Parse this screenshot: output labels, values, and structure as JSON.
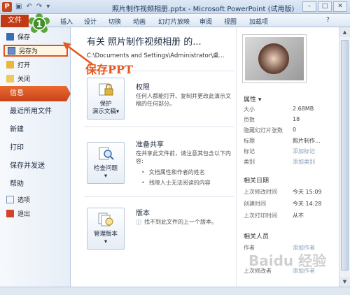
{
  "window": {
    "title": "照片制作视频相册.pptx - Microsoft PowerPoint (试用版)",
    "app_icon": "P",
    "controls": [
      "–",
      "□",
      "✕"
    ]
  },
  "ribbon": {
    "file_tab": "文件",
    "tabs": [
      "插入",
      "设计",
      "切换",
      "动画",
      "幻灯片放映",
      "审阅",
      "视图",
      "加载项"
    ]
  },
  "step_badge": "1",
  "left_menu": {
    "small_items": [
      {
        "label": "保存",
        "icon": "save-icon"
      },
      {
        "label": "另存为",
        "icon": "save-as-icon"
      },
      {
        "label": "打开",
        "icon": "open-folder-icon"
      },
      {
        "label": "关闭",
        "icon": "close-file-icon"
      }
    ],
    "big_items": [
      "信息",
      "最近所用文件",
      "新建",
      "打印",
      "保存并发送",
      "帮助"
    ],
    "bottom_items": [
      {
        "label": "选项",
        "icon": "options-icon"
      },
      {
        "label": "退出",
        "icon": "exit-icon"
      }
    ]
  },
  "annotation": "保存PPT",
  "info": {
    "title": "有关 照片制作视频相册 的...",
    "path": "C:\\Documents and Settings\\Administrator\\桌...",
    "sections": [
      {
        "button": [
          "保护",
          "演示文稿▾"
        ],
        "heading": "权限",
        "text": "任何人都能打开、复制并更改此演示文稿的任何部分。"
      },
      {
        "button": [
          "检查问题",
          "▾"
        ],
        "heading": "准备共享",
        "text": "在共享此文件前，请注意其包含以下内容:",
        "bullets": [
          "文档属性和作者的姓名",
          "残障人士无法阅读的内容"
        ]
      },
      {
        "button": [
          "管理版本",
          "▾"
        ],
        "heading": "版本",
        "text": "找不到此文件的上一个版本。"
      }
    ]
  },
  "properties": {
    "heading": "属性 ▾",
    "rows": [
      {
        "k": "大小",
        "v": "2.68MB"
      },
      {
        "k": "页数",
        "v": "18"
      },
      {
        "k": "隐藏幻灯片张数",
        "v": "0"
      },
      {
        "k": "标题",
        "v": "照片制作..."
      },
      {
        "k": "标记",
        "v": "添加标记"
      },
      {
        "k": "类别",
        "v": "添加类别"
      }
    ],
    "dates_heading": "相关日期",
    "dates": [
      {
        "k": "上次修改时间",
        "v": "今天 15:09"
      },
      {
        "k": "创建时间",
        "v": "今天 14:28"
      },
      {
        "k": "上次打印时间",
        "v": "从不"
      }
    ],
    "people_heading": "相关人员",
    "people": [
      {
        "k": "作者",
        "v": "添加作者"
      },
      {
        "k": "上次修改者",
        "v": "添加作者"
      }
    ]
  },
  "watermark": "Baidu 经验",
  "colors": {
    "accent": "#e4531f",
    "file_tab": "#c13a16"
  }
}
